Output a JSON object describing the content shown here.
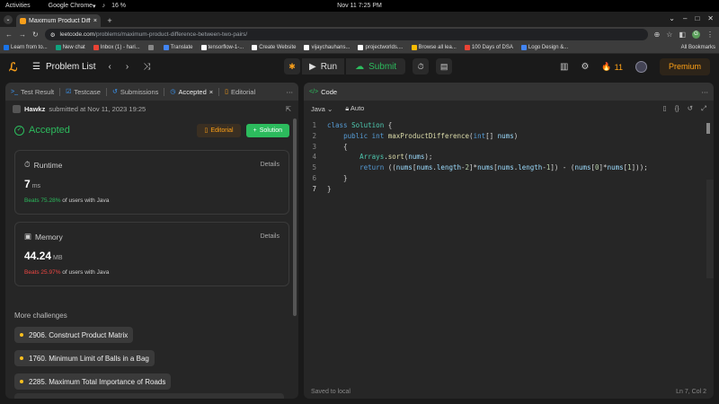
{
  "os": {
    "activities": "Activities",
    "app": "Google Chrome",
    "clock": "Nov 11  7:25 PM",
    "battery": "16 %"
  },
  "browser": {
    "tab_title": "Maximum Product Diffe",
    "url_host": "leetcode.com",
    "url_path": "/problems/maximum-product-difference-between-two-pairs/",
    "bookmarks": [
      {
        "label": "Learn from to...",
        "color": "#1a73e8"
      },
      {
        "label": "New chat",
        "color": "#10a37f"
      },
      {
        "label": "Inbox (1) - hari...",
        "color": "#ea4335"
      },
      {
        "label": "",
        "color": "#888888"
      },
      {
        "label": "Translate",
        "color": "#4285f4"
      },
      {
        "label": "tensorflow-1-...",
        "color": "#ffffff"
      },
      {
        "label": "Create Website",
        "color": "#ffffff"
      },
      {
        "label": "vijaychauhans...",
        "color": "#ffffff"
      },
      {
        "label": "projectworlds....",
        "color": "#ffffff"
      },
      {
        "label": "Browse all lea...",
        "color": "#fbbc04"
      },
      {
        "label": "100 Days of DSA",
        "color": "#ea4335"
      },
      {
        "label": "Logo Design &...",
        "color": "#4285f4"
      }
    ],
    "all_bookmarks": "All Bookmarks"
  },
  "nav": {
    "problem_list": "Problem List",
    "run": "Run",
    "submit": "Submit",
    "streak": "11",
    "premium": "Premium"
  },
  "left_tabs": {
    "test_result": "Test Result",
    "testcase": "Testcase",
    "submissions": "Submissions",
    "accepted": "Accepted",
    "editorial": "Editorial"
  },
  "submission": {
    "user": "Hawkz",
    "submitted_text": "submitted at Nov 11, 2023 19:25"
  },
  "result": {
    "status": "Accepted",
    "editorial_btn": "Editorial",
    "solution_btn": "Solution"
  },
  "runtime": {
    "title": "Runtime",
    "details": "Details",
    "value": "7",
    "unit": "ms",
    "beats": "Beats 75.28%",
    "beats_suffix": "of users with Java"
  },
  "memory": {
    "title": "Memory",
    "details": "Details",
    "value": "44.24",
    "unit": "MB",
    "beats": "Beats 25.97%",
    "beats_suffix": "of users with Java"
  },
  "more": {
    "title": "More challenges",
    "items": [
      "2906. Construct Product Matrix",
      "1760. Minimum Limit of Balls in a Bag",
      "2285. Maximum Total Importance of Roads"
    ]
  },
  "code_panel": {
    "title": "Code",
    "language": "Java",
    "auto": "Auto",
    "status_left": "Saved to local",
    "status_right": "Ln 7, Col 2",
    "line_numbers": [
      "1",
      "2",
      "3",
      "4",
      "5",
      "6",
      "7"
    ]
  },
  "colors": {
    "accent": "#ffa116",
    "success": "#2cbb5d",
    "danger": "#ef4743"
  }
}
